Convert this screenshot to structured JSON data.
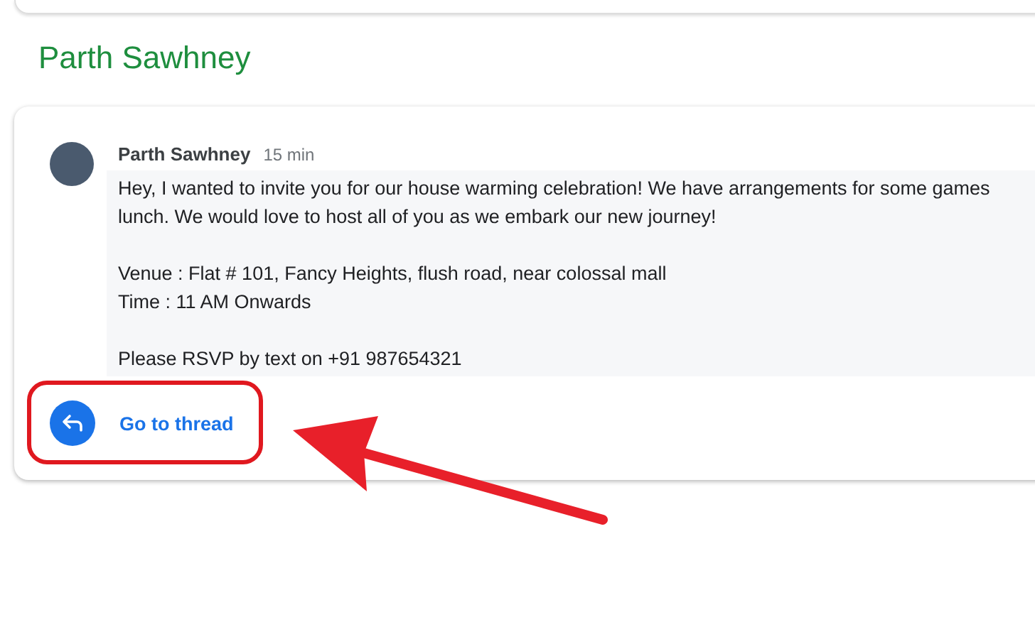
{
  "heading": "Parth Sawhney",
  "message": {
    "sender": "Parth Sawhney",
    "time": "15 min",
    "paragraphs": [
      {
        "lines": [
          "Hey,  I wanted to invite you for our house warming celebration! We have arrangements for some games",
          "lunch. We would love to host all of you as we embark our new journey!"
        ]
      },
      {
        "lines": [
          "Venue : Flat # 101, Fancy Heights, flush road,  near colossal mall",
          "Time : 11 AM Onwards"
        ]
      },
      {
        "lines": [
          "Please RSVP by text on +91 987654321"
        ]
      }
    ]
  },
  "thread_link": {
    "label": "Go to thread"
  }
}
